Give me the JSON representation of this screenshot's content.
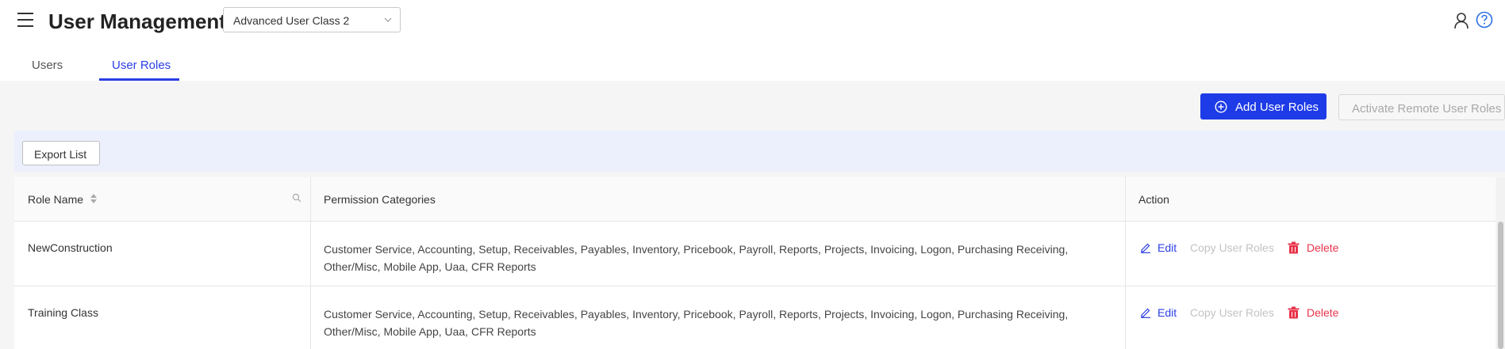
{
  "header": {
    "title": "User Management",
    "class_select": "Advanced User Class 2"
  },
  "tabs": [
    {
      "label": "Users",
      "active": false
    },
    {
      "label": "User Roles",
      "active": true
    }
  ],
  "actions": {
    "add_label": "Add User Roles",
    "activate_label": "Activate Remote User Roles",
    "export_label": "Export List"
  },
  "table": {
    "columns": [
      "Role Name",
      "Permission Categories",
      "Action"
    ],
    "rows": [
      {
        "name": "NewConstruction",
        "permissions": "Customer Service, Accounting, Setup, Receivables, Payables, Inventory, Pricebook, Payroll, Reports, Projects, Invoicing, Logon, Purchasing Receiving, Other/Misc, Mobile App, Uaa, CFR Reports"
      },
      {
        "name": "Training Class",
        "permissions": "Customer Service, Accounting, Setup, Receivables, Payables, Inventory, Pricebook, Payroll, Reports, Projects, Invoicing, Logon, Purchasing Receiving, Other/Misc, Mobile App, Uaa, CFR Reports"
      }
    ],
    "row_actions": {
      "edit": "Edit",
      "copy": "Copy User Roles",
      "delete": "Delete"
    }
  },
  "colors": {
    "accent": "#1e3be8",
    "link": "#2b3ee6",
    "danger": "#e8334a",
    "disabled": "#c3c3c3",
    "toolbar_bg": "#ecf0fd"
  },
  "icons": [
    "menu-icon",
    "chevron-down-icon",
    "user-icon",
    "help-icon",
    "plus-circle-icon",
    "sort-icon",
    "search-icon",
    "edit-icon",
    "trash-icon"
  ]
}
